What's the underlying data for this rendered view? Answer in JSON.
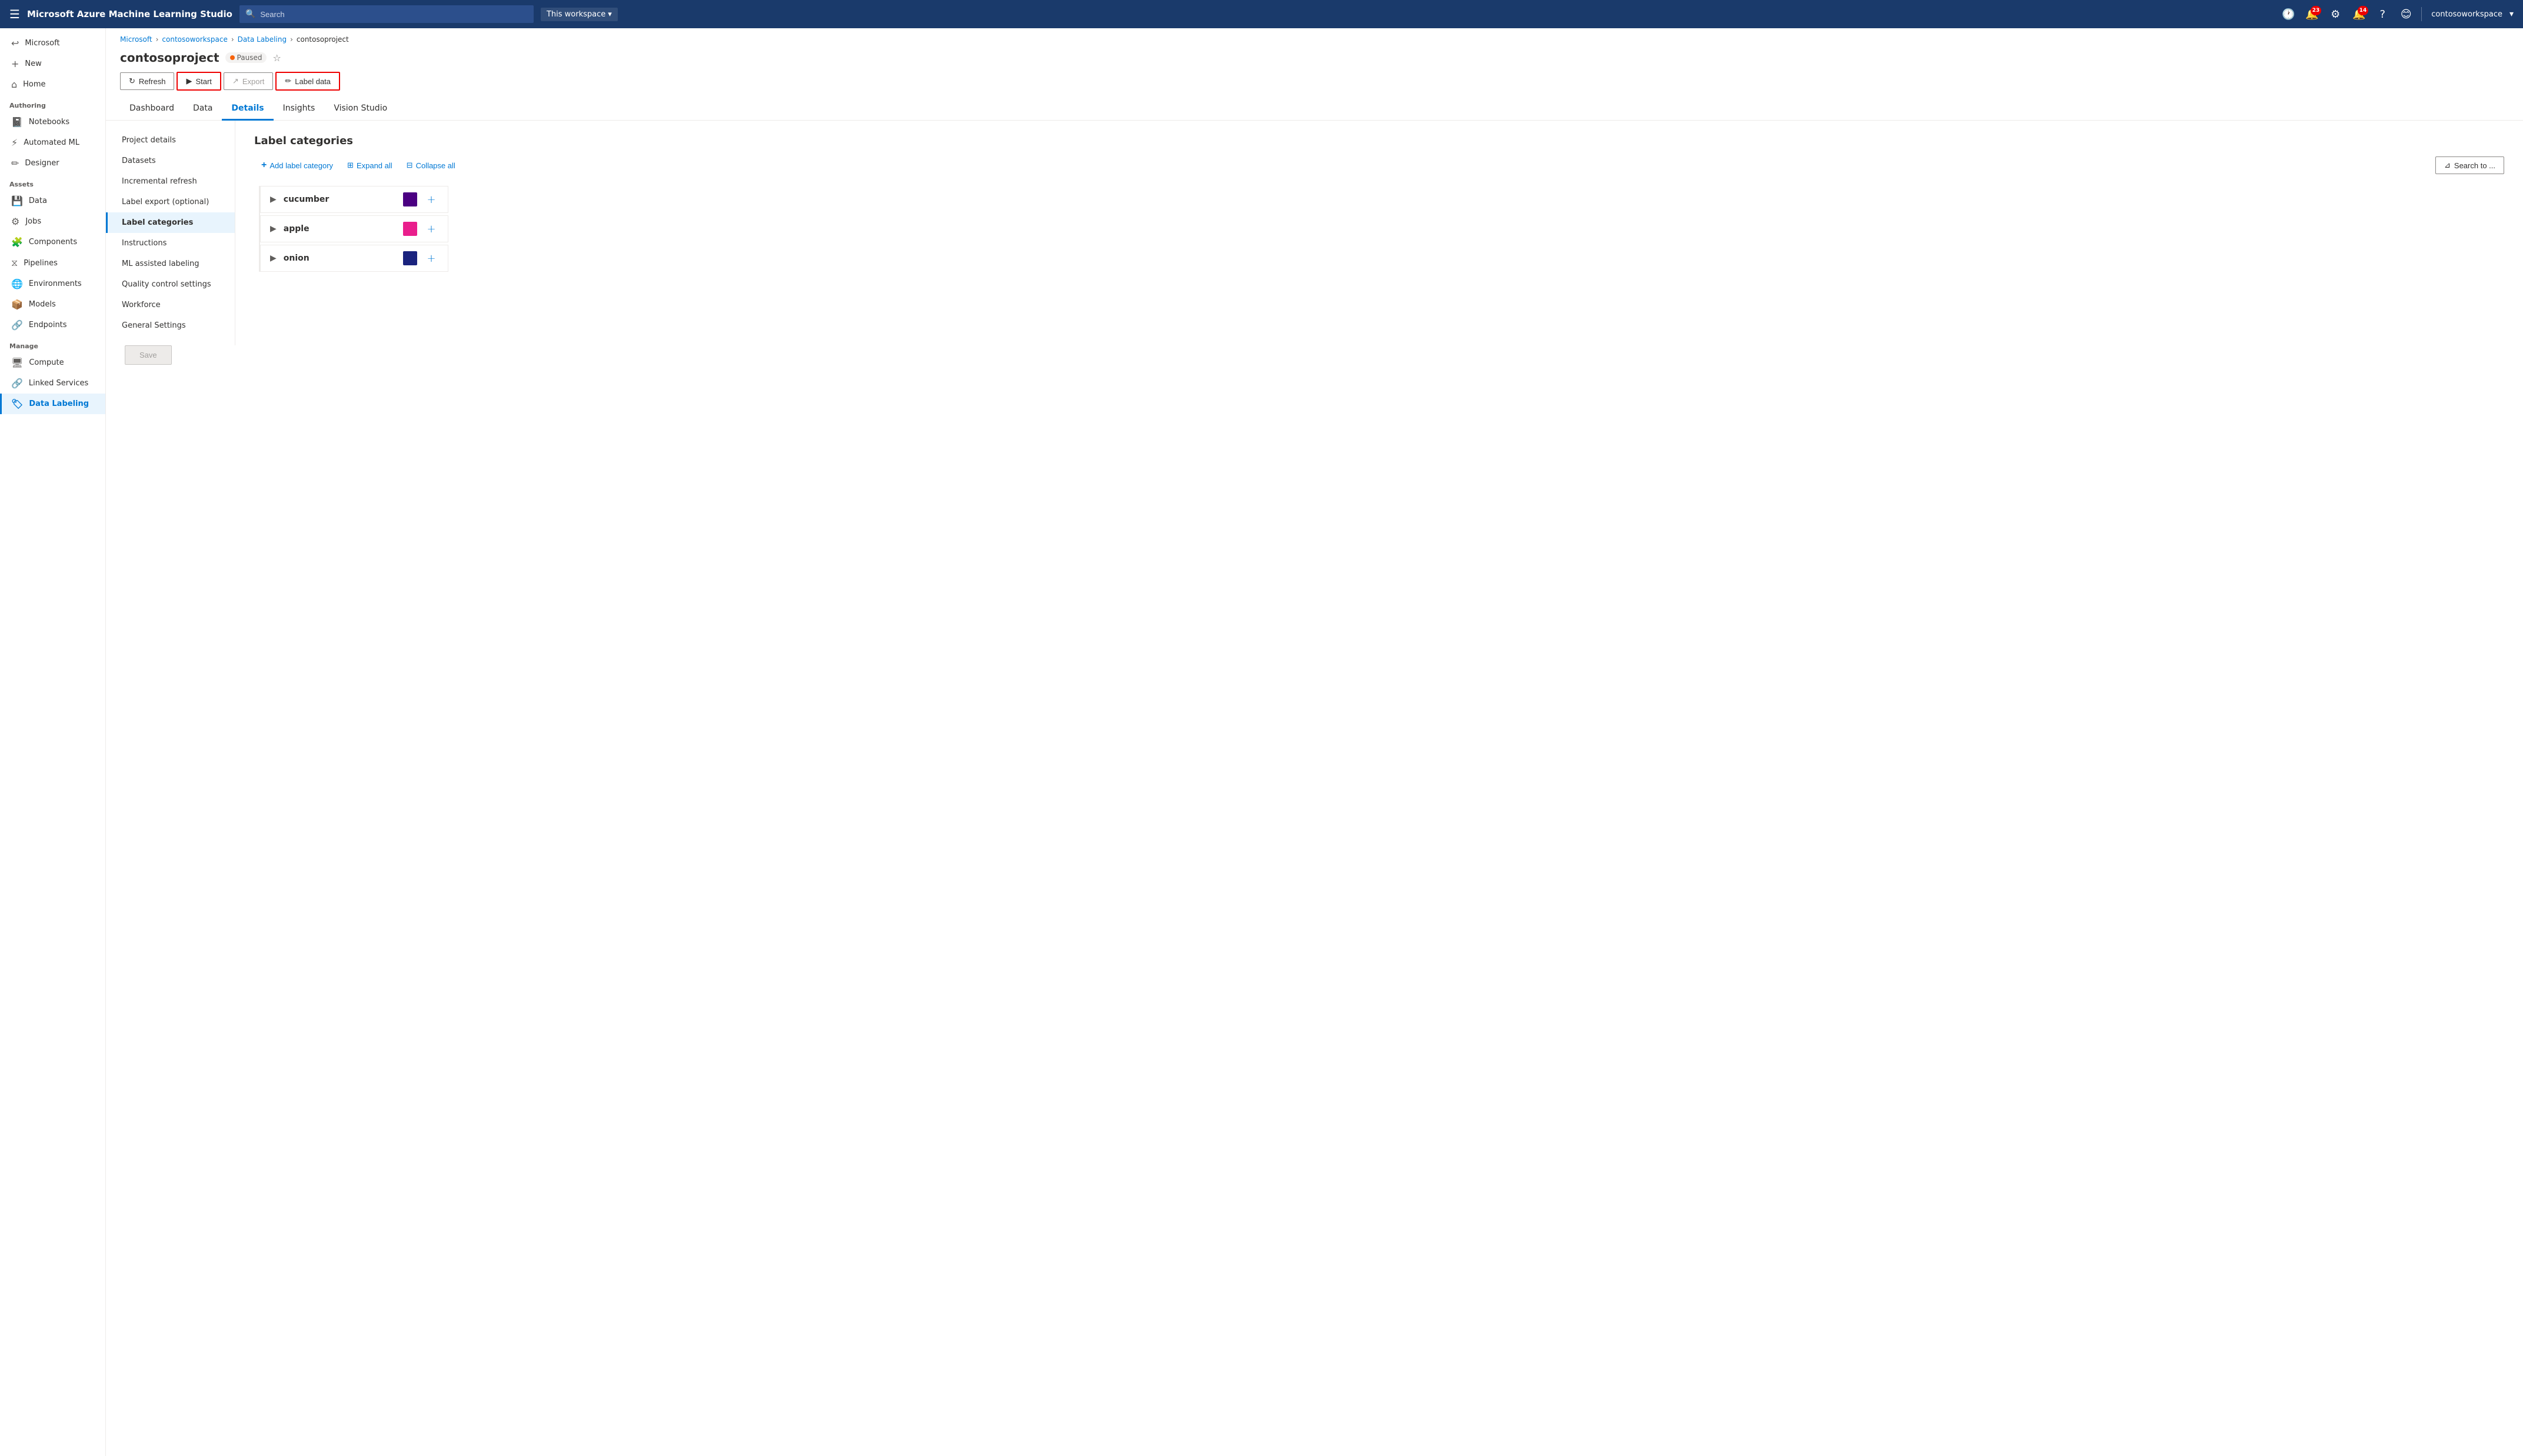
{
  "topNav": {
    "title": "Microsoft Azure Machine Learning Studio",
    "searchPlaceholder": "Search",
    "workspaceLabel": "This workspace",
    "notificationCount1": "23",
    "notificationCount2": "14",
    "username": "contosoworkspace"
  },
  "breadcrumb": {
    "items": [
      "Microsoft",
      "contosoworkspace",
      "Data Labeling"
    ],
    "current": "contosoproject"
  },
  "pageHeader": {
    "title": "contosoproject",
    "statusLabel": "Paused"
  },
  "toolbar": {
    "refreshLabel": "Refresh",
    "startLabel": "Start",
    "exportLabel": "Export",
    "labelDataLabel": "Label data"
  },
  "tabs": [
    {
      "label": "Dashboard"
    },
    {
      "label": "Data"
    },
    {
      "label": "Details",
      "active": true
    },
    {
      "label": "Insights"
    },
    {
      "label": "Vision Studio"
    }
  ],
  "leftNav": [
    {
      "label": "Project details"
    },
    {
      "label": "Datasets"
    },
    {
      "label": "Incremental refresh"
    },
    {
      "label": "Label export (optional)"
    },
    {
      "label": "Label categories",
      "active": true
    },
    {
      "label": "Instructions"
    },
    {
      "label": "ML assisted labeling"
    },
    {
      "label": "Quality control settings"
    },
    {
      "label": "Workforce"
    },
    {
      "label": "General Settings"
    }
  ],
  "labelCategories": {
    "title": "Label categories",
    "addLabel": "Add label category",
    "expandAll": "Expand all",
    "collapseAll": "Collapse all",
    "searchPlaceholder": "Search to ...",
    "items": [
      {
        "name": "cucumber",
        "color": "#4b0082"
      },
      {
        "name": "apple",
        "color": "#e91e8c"
      },
      {
        "name": "onion",
        "color": "#1a237e"
      }
    ]
  },
  "sidebar": {
    "items": [
      {
        "icon": "≡",
        "label": ""
      },
      {
        "icon": "↩",
        "label": "Microsoft",
        "section": null
      },
      {
        "section": null
      },
      {
        "icon": "+",
        "label": "New"
      },
      {
        "icon": "⌂",
        "label": "Home"
      },
      {
        "sectionLabel": "Authoring"
      },
      {
        "icon": "📓",
        "label": "Notebooks"
      },
      {
        "icon": "⚡",
        "label": "Automated ML"
      },
      {
        "icon": "✏",
        "label": "Designer"
      },
      {
        "sectionLabel": "Assets"
      },
      {
        "icon": "💾",
        "label": "Data"
      },
      {
        "icon": "⚙",
        "label": "Jobs"
      },
      {
        "icon": "🧩",
        "label": "Components"
      },
      {
        "icon": "⧖",
        "label": "Pipelines"
      },
      {
        "icon": "🌐",
        "label": "Environments"
      },
      {
        "icon": "📦",
        "label": "Models"
      },
      {
        "icon": "🔗",
        "label": "Endpoints"
      },
      {
        "sectionLabel": "Manage"
      },
      {
        "icon": "🖥",
        "label": "Compute"
      },
      {
        "icon": "🔗",
        "label": "Linked Services"
      },
      {
        "icon": "🏷",
        "label": "Data Labeling",
        "active": true
      }
    ]
  },
  "saveButton": "Save"
}
